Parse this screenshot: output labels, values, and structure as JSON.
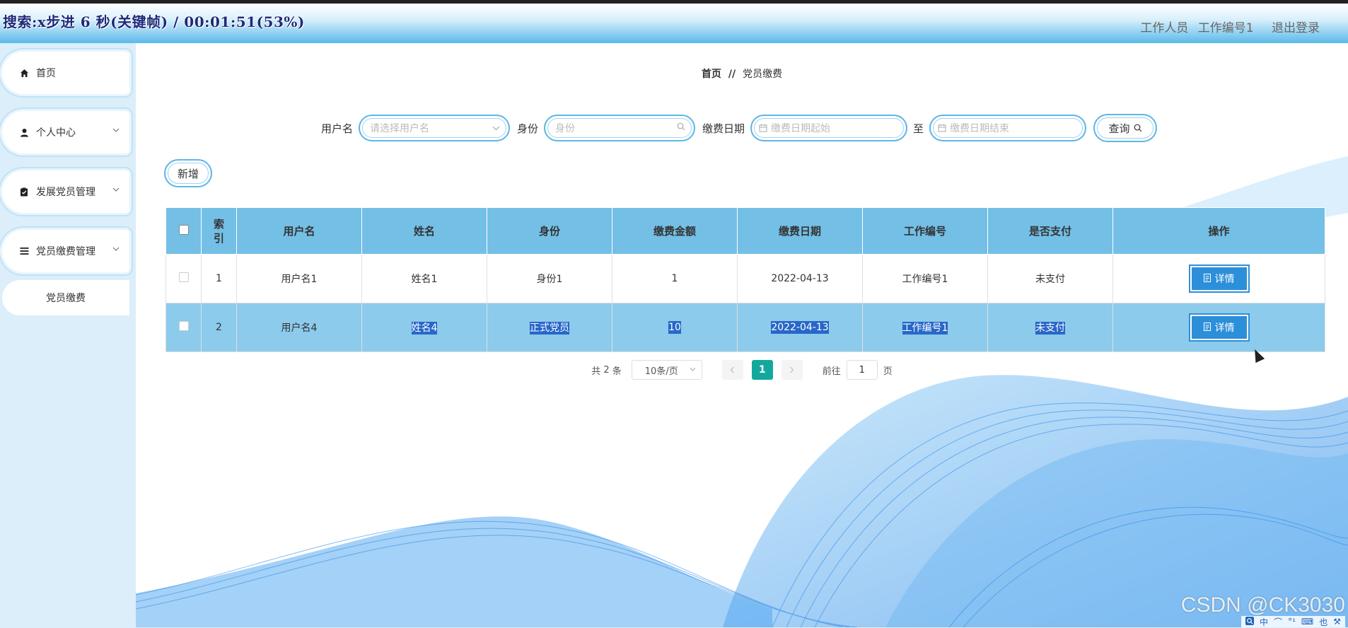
{
  "overlay_text": "搜索:x步进 6 秒(关键帧) / 00:01:51(53%)",
  "header": {
    "role": "工作人员",
    "work_no": "工作编号1",
    "logout": "退出登录"
  },
  "sidebar": {
    "items": [
      {
        "label": "首页",
        "icon": "home-icon"
      },
      {
        "label": "个人中心",
        "icon": "user-icon"
      },
      {
        "label": "发展党员管理",
        "icon": "clipboard-icon"
      },
      {
        "label": "党员缴费管理",
        "icon": "menu-icon"
      }
    ],
    "submenu": "党员缴费"
  },
  "breadcrumb": {
    "home": "首页",
    "sep": "//",
    "current": "党员缴费"
  },
  "search": {
    "username_label": "用户名",
    "username_placeholder": "请选择用户名",
    "identity_label": "身份",
    "identity_placeholder": "身份",
    "date_label": "缴费日期",
    "date_start_placeholder": "缴费日期起始",
    "to_label": "至",
    "date_end_placeholder": "缴费日期结束",
    "query_button": "查询"
  },
  "add_button": "新增",
  "table": {
    "headers": [
      "索\n引",
      "用户名",
      "姓名",
      "身份",
      "缴费金额",
      "缴费日期",
      "工作编号",
      "是否支付",
      "操作"
    ],
    "rows": [
      {
        "index": "1",
        "username": "用户名1",
        "name": "姓名1",
        "identity": "身份1",
        "amount": "1",
        "date": "2022-04-13",
        "work_no": "工作编号1",
        "paid": "未支付",
        "action": "详情"
      },
      {
        "index": "2",
        "username": "用户名4",
        "name": "姓名4",
        "identity": "正式党员",
        "amount": "10",
        "date": "2022-04-13",
        "work_no": "工作编号1",
        "paid": "未支付",
        "action": "详情"
      }
    ]
  },
  "pager": {
    "total_prefix": "共",
    "total": "2",
    "total_suffix": "条",
    "page_size": "10条/页",
    "current_page": "1",
    "goto_label": "前往",
    "goto_value": "1",
    "page_suffix": "页"
  },
  "watermark": "CSDN @CK3030",
  "tray": [
    "中",
    "⌒",
    "°¹",
    "⌨",
    "也",
    "⚒"
  ]
}
